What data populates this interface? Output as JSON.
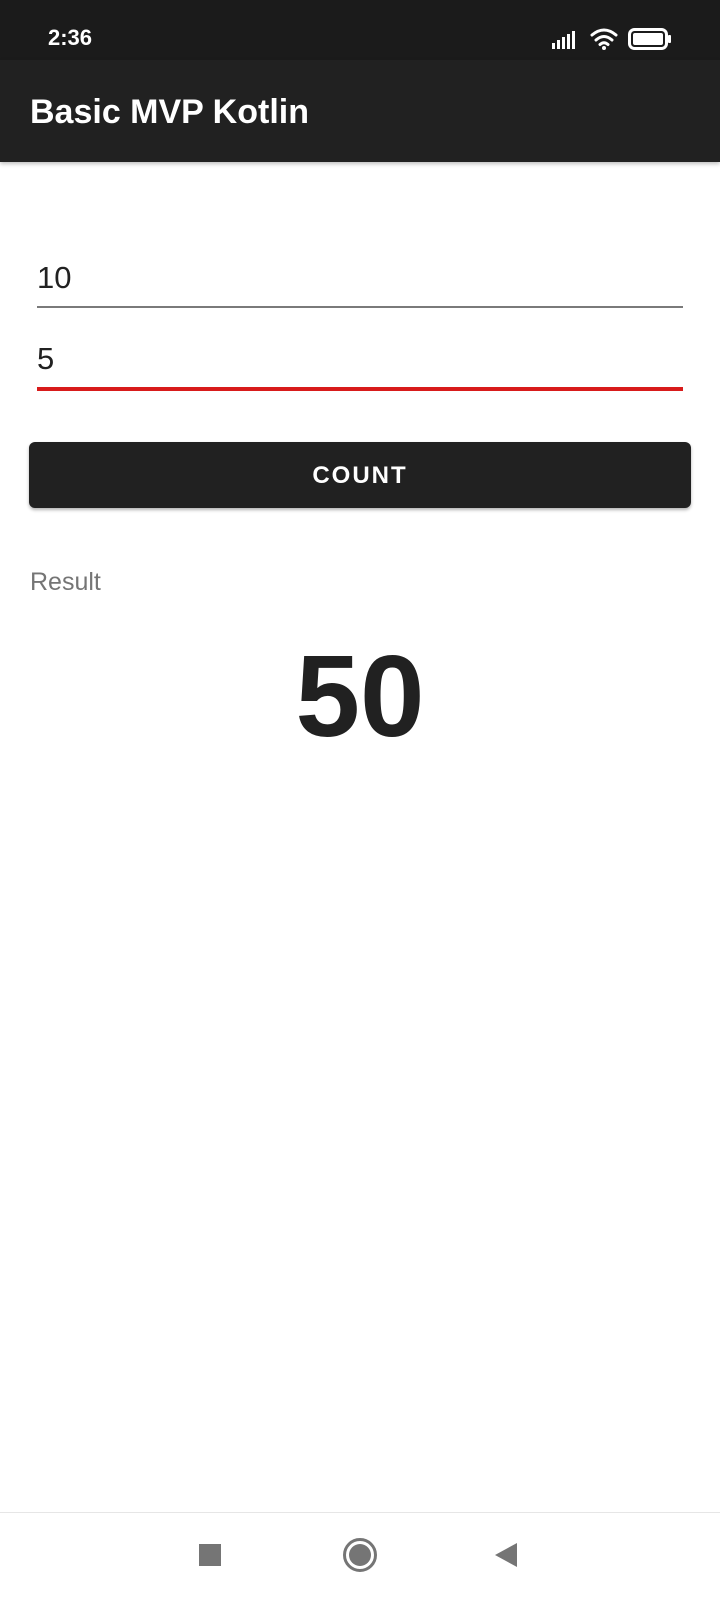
{
  "status_bar": {
    "time": "2:36",
    "icons": [
      "signal-icon",
      "wifi-icon",
      "battery-icon"
    ]
  },
  "app_bar": {
    "title": "Basic MVP Kotlin"
  },
  "form": {
    "first_value": "10",
    "second_value": "5",
    "count_label": "COUNT"
  },
  "result": {
    "label": "Result",
    "value": "50"
  },
  "nav_bar": {
    "icons": [
      "recent-apps-icon",
      "home-icon",
      "back-icon"
    ]
  },
  "colors": {
    "status_bar": "#1b1b1b",
    "app_bar": "#212121",
    "button": "#212121",
    "focused_underline": "#d81b1b",
    "underline": "#7a7a7a"
  }
}
